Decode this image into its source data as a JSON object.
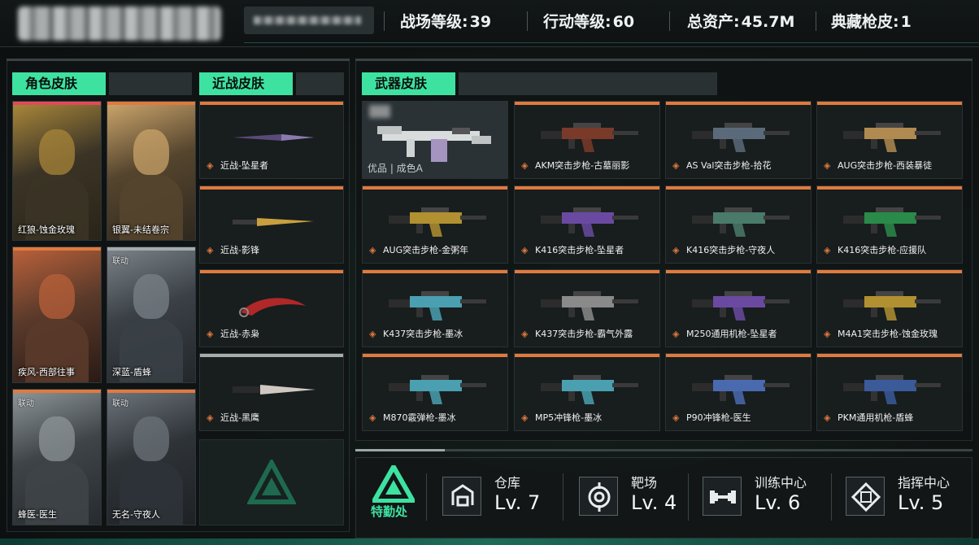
{
  "header": {
    "battlefield_level_label": "战场等级:",
    "battlefield_level": "39",
    "operation_level_label": "行动等级:",
    "operation_level": "60",
    "total_assets_label": "总资产:",
    "total_assets": "45.7M",
    "collection_skins_label": "典藏枪皮:",
    "collection_skins": "1"
  },
  "role_skins": {
    "title": "角色皮肤",
    "items": [
      {
        "label": "红狼-蚀金玫瑰",
        "tag": ""
      },
      {
        "label": "银翼-未结卷宗",
        "tag": ""
      },
      {
        "label": "疾风-西部往事",
        "tag": ""
      },
      {
        "label": "深蓝-盾蜂",
        "tag": "联动"
      },
      {
        "label": "蜂医-医生",
        "tag": "联动"
      },
      {
        "label": "无名-守夜人",
        "tag": "联动"
      }
    ]
  },
  "melee_skins": {
    "title": "近战皮肤",
    "items": [
      {
        "label": "近战-坠星者"
      },
      {
        "label": "近战-影锋"
      },
      {
        "label": "近战-赤枭"
      },
      {
        "label": "近战-黑鹰"
      }
    ]
  },
  "weapon_skins": {
    "title": "武器皮肤",
    "featured_label": "优品 | 成色A",
    "items": [
      {
        "label": "AKM突击步枪-古墓丽影",
        "color": "#7a3a2a"
      },
      {
        "label": "AS Val突击步枪-拾花",
        "color": "#5a6a7a"
      },
      {
        "label": "AUG突击步枪-西装暴徒",
        "color": "#b08a50"
      },
      {
        "label": "AUG突击步枪-金粥年",
        "color": "#b09030"
      },
      {
        "label": "K416突击步枪-坠星者",
        "color": "#6a4aa0"
      },
      {
        "label": "K416突击步枪-守夜人",
        "color": "#4a7a6a"
      },
      {
        "label": "K416突击步枪-应援队",
        "color": "#2a8a4a"
      },
      {
        "label": "K437突击步枪-墨冰",
        "color": "#4aa0b0"
      },
      {
        "label": "K437突击步枪-霸气外露",
        "color": "#8a8a8a"
      },
      {
        "label": "M250通用机枪-坠星者",
        "color": "#6a4aa0"
      },
      {
        "label": "M4A1突击步枪-蚀金玫瑰",
        "color": "#b09030"
      },
      {
        "label": "M870霰弹枪-墨冰",
        "color": "#4aa0b0"
      },
      {
        "label": "MP5冲锋枪-墨冰",
        "color": "#4aa0b0"
      },
      {
        "label": "P90冲锋枪-医生",
        "color": "#4a6ab0"
      },
      {
        "label": "PKM通用机枪-盾蜂",
        "color": "#3a5a9a"
      }
    ]
  },
  "facilities": {
    "duty_office": "特勤处",
    "items": [
      {
        "name": "仓库",
        "level": "Lv. 7",
        "icon": "warehouse-icon"
      },
      {
        "name": "靶场",
        "level": "Lv. 4",
        "icon": "target-icon"
      },
      {
        "name": "训练中心",
        "level": "Lv. 6",
        "icon": "dumbbell-icon"
      },
      {
        "name": "指挥中心",
        "level": "Lv. 5",
        "icon": "command-chip-icon"
      }
    ]
  },
  "accent_colors": {
    "header_green": "#3ee2a0",
    "card_orange": "#e07a3e",
    "card_red": "#e24a58"
  }
}
